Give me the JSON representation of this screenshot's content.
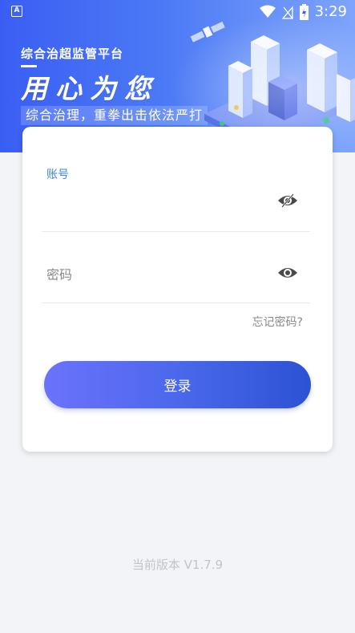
{
  "status_bar": {
    "app_indicator": "A",
    "time": "3:29",
    "icons": [
      "wifi-icon",
      "signal-icon",
      "battery-charging-icon"
    ]
  },
  "banner": {
    "title": "综合治超监管平台",
    "slogan": "用心为您",
    "subtitle": "综合治理，重拳出击依法严打"
  },
  "form": {
    "username_label": "账号",
    "password_placeholder": "密码",
    "forgot_password": "忘记密码?",
    "login_button": "登录"
  },
  "footer": {
    "version": "当前版本 V1.7.9"
  },
  "colors": {
    "accent": "#3b86e6",
    "button_start": "#6b72fb",
    "button_end": "#2c52d4",
    "banner_start": "#3a5ef3"
  }
}
